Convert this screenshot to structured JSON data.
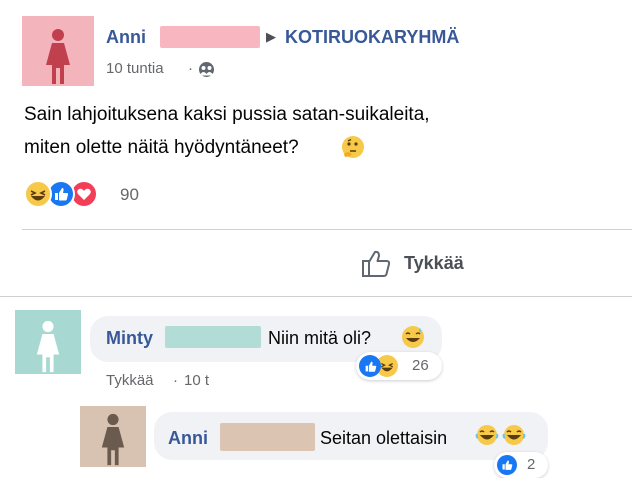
{
  "post": {
    "author_first_name": "Anni",
    "group_name": "KOTIRUOKARYHMÄ",
    "time": "10 tuntia",
    "separator": "·",
    "text_line1": "Sain lahjoituksena kaksi pussia satan-suikaleita,",
    "text_line2": "miten olette näitä hyödyntäneet?",
    "reaction_count": "90",
    "like_button_label": "Tykkää"
  },
  "comments": [
    {
      "author": "Minty",
      "text": "Niin mitä oli?",
      "like_label": "Tykkää",
      "separator": "·",
      "time": "10 t",
      "reaction_count": "26"
    },
    {
      "author": "Anni",
      "text": "Seitan olettaisin",
      "reaction_count": "2"
    }
  ],
  "colors": {
    "name_blue": "#385898",
    "avatar_anni_bg": "#f4b4bc",
    "avatar_anni_figure": "#c0404e",
    "redact_anni": "#f7b6c0",
    "avatar_minty_bg": "#a8d8d2",
    "redact_minty": "#b2dcd6",
    "avatar_reply_bg": "#d8c2b2",
    "avatar_reply_figure": "#6b5a4e",
    "redact_reply": "#dcc4b2"
  },
  "icons": [
    "woman-figure-icon",
    "globe-group-icon",
    "haha-emoji-icon",
    "like-reaction-icon",
    "love-reaction-icon",
    "thumbs-up-outline-icon",
    "thinking-emoji-icon",
    "sweat-smile-emoji-icon",
    "triangle-arrow-icon"
  ]
}
